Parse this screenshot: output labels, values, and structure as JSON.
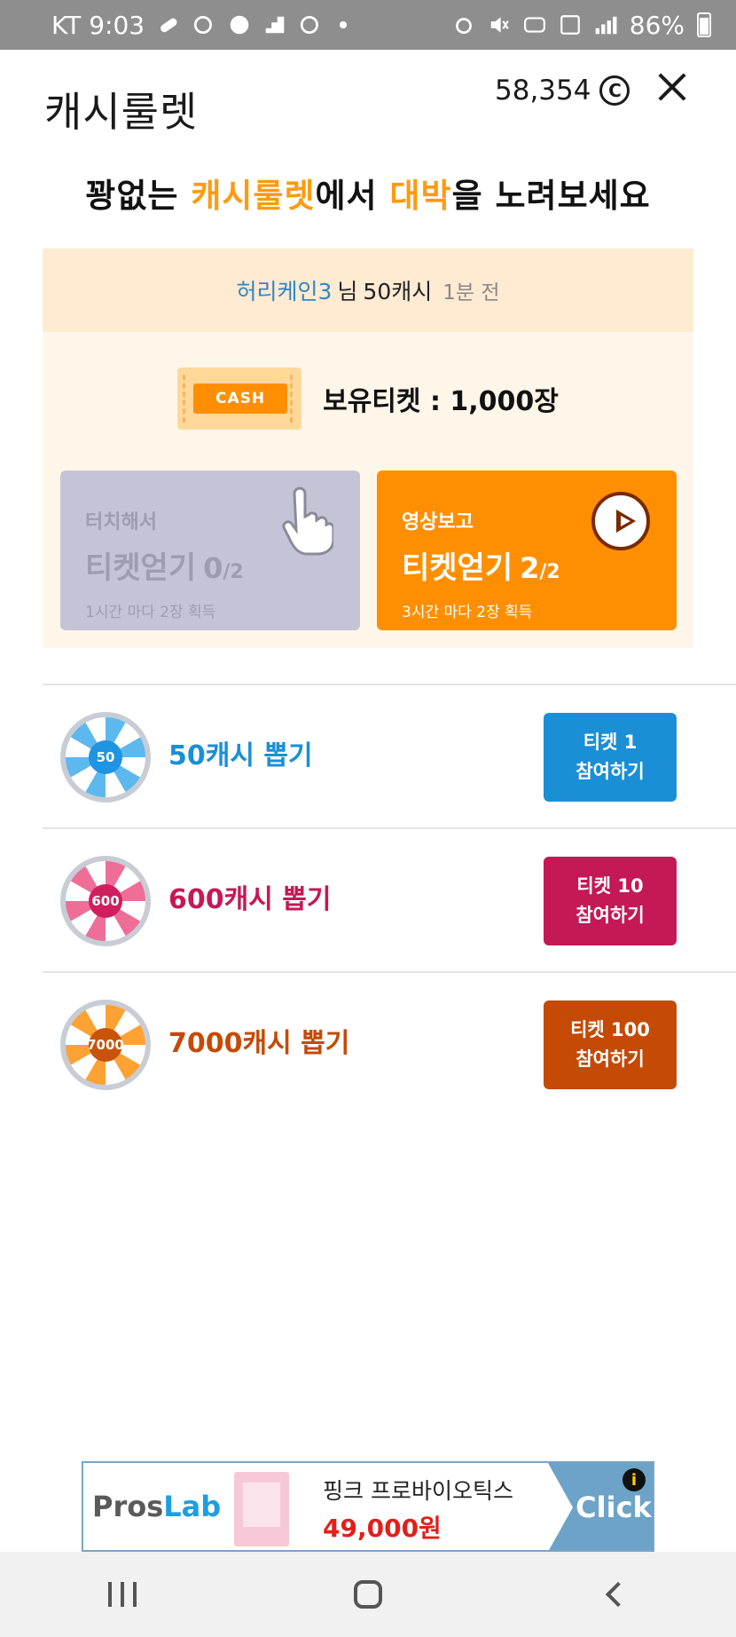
{
  "status_bar": {
    "carrier_time": "KT 9:03",
    "battery": "86%"
  },
  "header": {
    "title": "캐시룰렛",
    "balance": "58,354",
    "coin_symbol": "C"
  },
  "headline": {
    "part1": "꽝없는 ",
    "part2": "캐시룰렛",
    "part3": "에서 ",
    "part4": "대박",
    "part5": "을 노려보세요"
  },
  "ticker": {
    "user": "허리케인3",
    "suffix": "님",
    "amount": "50캐시",
    "time": "1분 전"
  },
  "tickets": {
    "icon_label": "CASH",
    "owned_label": "보유티켓 : 1,000장"
  },
  "earn_touch": {
    "sub": "터치해서",
    "main": "티켓얻기",
    "count": "0",
    "total": "/2",
    "note": "1시간 마다 2장 획득"
  },
  "earn_video": {
    "sub": "영상보고",
    "main": "티켓얻기",
    "count": "2",
    "total": "/2",
    "note": "3시간 마다 2장 획득"
  },
  "roulettes": [
    {
      "hub": "50",
      "label": "50캐시 뽑기",
      "btn_line1": "티켓 1",
      "btn_line2": "참여하기",
      "color": "#1a8fd6",
      "light": "#5db8ee",
      "hub_color": "#1e94e2"
    },
    {
      "hub": "600",
      "label": "600캐시 뽑기",
      "btn_line1": "티켓 10",
      "btn_line2": "참여하기",
      "color": "#c51856",
      "light": "#ee6e98",
      "hub_color": "#cf1f5e"
    },
    {
      "hub": "7000",
      "label": "7000캐시 뽑기",
      "btn_line1": "티켓 100",
      "btn_line2": "참여하기",
      "color": "#c44a05",
      "light": "#ffa234",
      "hub_color": "#c9530a"
    }
  ],
  "ad": {
    "brand_a": "Pros",
    "brand_b": "Lab",
    "product_name": "핑크 프로바이오틱스",
    "price": "49,000원",
    "cta": "Click",
    "info": "i"
  }
}
